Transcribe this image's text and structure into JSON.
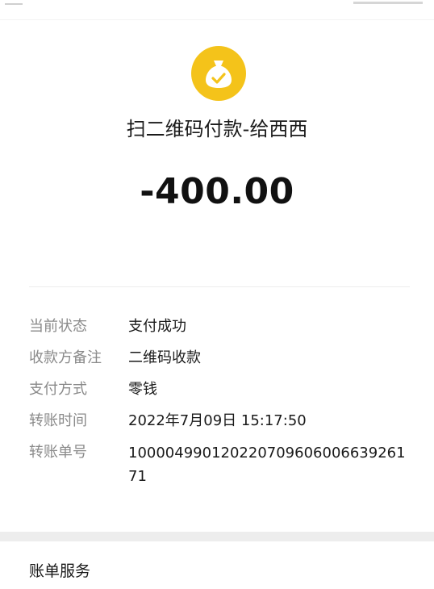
{
  "transaction": {
    "merchant_title": "扫二维码付款-给西西",
    "amount": "-400.00",
    "icon": "money-bag-check-icon",
    "accent_color": "#f4c31a"
  },
  "details": [
    {
      "label": "当前状态",
      "value": "支付成功"
    },
    {
      "label": "收款方备注",
      "value": "二维码收款"
    },
    {
      "label": "支付方式",
      "value": "零钱"
    },
    {
      "label": "转账时间",
      "value": "2022年7月09日 15:17:50"
    },
    {
      "label": "转账单号",
      "value": "100004990120220709606006639261 71"
    }
  ],
  "footer": {
    "service_label": "账单服务"
  }
}
